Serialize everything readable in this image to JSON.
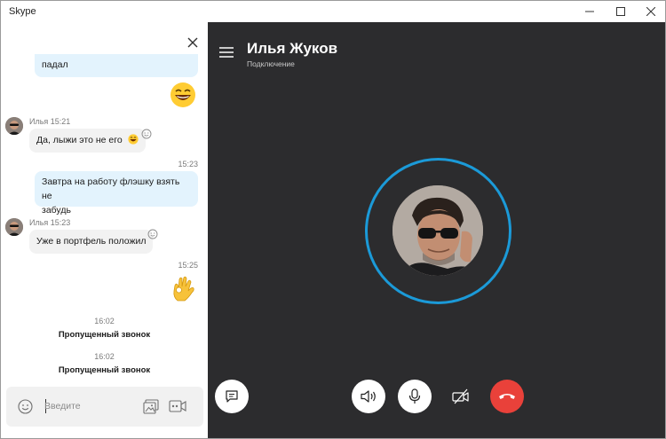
{
  "window": {
    "title": "Skype",
    "controls": [
      "minimize-icon",
      "maximize-icon",
      "close-icon"
    ]
  },
  "chat": {
    "messages": [
      {
        "type": "outgoing",
        "text": "падал"
      },
      {
        "type": "emoji",
        "icon": "laughing-emoji-icon"
      },
      {
        "type": "incoming",
        "sender": "Илья",
        "time": "15:21",
        "meta": "Илья 15:21",
        "text": "Да, лыжи это не его",
        "inline_icon": "laughing-emoji-icon"
      },
      {
        "type": "outgoing",
        "time": "15:23",
        "text_line1": "Завтра на работу флэшку взять не",
        "text_line2": "забудь"
      },
      {
        "type": "incoming",
        "sender": "Илья",
        "time": "15:23",
        "meta": "Илья 15:23",
        "text": "Уже в портфель положил"
      },
      {
        "type": "emoji",
        "time": "15:25",
        "icon": "ok-hand-emoji-icon"
      }
    ],
    "missed_calls": [
      {
        "time": "16:02",
        "label": "Пропущенный звонок"
      },
      {
        "time": "16:02",
        "label": "Пропущенный звонок"
      }
    ],
    "compose": {
      "placeholder": "Введите"
    }
  },
  "call": {
    "callee_name": "Илья Жуков",
    "status": "Подключение",
    "colors": {
      "background": "#2c2c2e",
      "ring": "#1b9ad8",
      "end_call": "#e9413a"
    },
    "controls": [
      "chat-icon",
      "speaker-icon",
      "microphone-icon",
      "video-off-icon",
      "end-call-icon"
    ]
  }
}
